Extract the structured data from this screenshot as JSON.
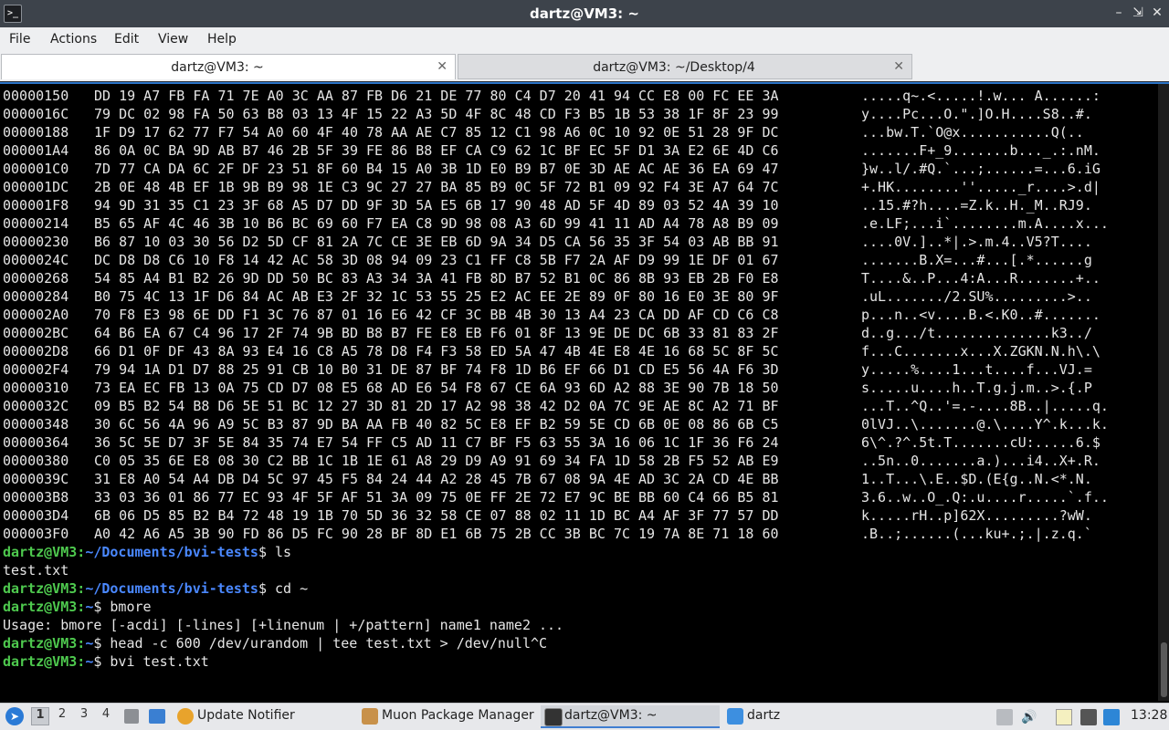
{
  "window": {
    "title": "dartz@VM3: ~",
    "icon": "terminal-icon",
    "controls": [
      "minimize-icon",
      "maximize-icon",
      "close-icon"
    ]
  },
  "menu": [
    "File",
    "Actions",
    "Edit",
    "View",
    "Help"
  ],
  "tabs": [
    {
      "label": "dartz@VM3: ~",
      "active": true
    },
    {
      "label": "dartz@VM3: ~/Desktop/4",
      "active": false
    }
  ],
  "hexdump": [
    {
      "addr": "00000150",
      "bytes": "DD 19 A7 FB FA 71 7E A0 3C AA 87 FB D6 21 DE 77 80 C4 D7 20 41 94 CC E8 00 FC EE 3A",
      "ascii": ".....q~.<.....!.w... A......:"
    },
    {
      "addr": "0000016C",
      "bytes": "79 DC 02 98 FA 50 63 B8 03 13 4F 15 22 A3 5D 4F 8C 48 CD F3 B5 1B 53 38 1F 8F 23 99",
      "ascii": "y....Pc...O.\".]O.H....S8..#."
    },
    {
      "addr": "00000188",
      "bytes": "1F D9 17 62 77 F7 54 A0 60 4F 40 78 AA AE C7 85 12 C1 98 A6 0C 10 92 0E 51 28 9F DC",
      "ascii": "...bw.T.`O@x...........Q(.."
    },
    {
      "addr": "000001A4",
      "bytes": "86 0A 0C BA 9D AB B7 46 2B 5F 39 FE 86 B8 EF CA C9 62 1C BF EC 5F D1 3A E2 6E 4D C6",
      "ascii": ".......F+_9.......b..._.:.nM."
    },
    {
      "addr": "000001C0",
      "bytes": "7D 77 CA DA 6C 2F DF 23 51 8F 60 B4 15 A0 3B 1D E0 B9 B7 0E 3D AE AC AE 36 EA 69 47",
      "ascii": "}w..l/.#Q.`...;......=...6.iG"
    },
    {
      "addr": "000001DC",
      "bytes": "2B 0E 48 4B EF 1B 9B B9 98 1E C3 9C 27 27 BA 85 B9 0C 5F 72 B1 09 92 F4 3E A7 64 7C",
      "ascii": "+.HK........''....._r....>.d|"
    },
    {
      "addr": "000001F8",
      "bytes": "94 9D 31 35 C1 23 3F 68 A5 D7 DD 9F 3D 5A E5 6B 17 90 48 AD 5F 4D 89 03 52 4A 39 10",
      "ascii": "..15.#?h....=Z.k..H._M..RJ9."
    },
    {
      "addr": "00000214",
      "bytes": "B5 65 AF 4C 46 3B 10 B6 BC 69 60 F7 EA C8 9D 98 08 A3 6D 99 41 11 AD A4 78 A8 B9 09",
      "ascii": ".e.LF;...i`........m.A....x..."
    },
    {
      "addr": "00000230",
      "bytes": "B6 87 10 03 30 56 D2 5D CF 81 2A 7C CE 3E EB 6D 9A 34 D5 CA 56 35 3F 54 03 AB BB 91",
      "ascii": "....0V.]..*|.>.m.4..V5?T...."
    },
    {
      "addr": "0000024C",
      "bytes": "DC D8 D8 C6 10 F8 14 42 AC 58 3D 08 94 09 23 C1 FF C8 5B F7 2A AF D9 99 1E DF 01 67",
      "ascii": ".......B.X=...#...[.*......g"
    },
    {
      "addr": "00000268",
      "bytes": "54 85 A4 B1 B2 26 9D DD 50 BC 83 A3 34 3A 41 FB 8D B7 52 B1 0C 86 8B 93 EB 2B F0 E8",
      "ascii": "T....&..P...4:A...R.......+.."
    },
    {
      "addr": "00000284",
      "bytes": "B0 75 4C 13 1F D6 84 AC AB E3 2F 32 1C 53 55 25 E2 AC EE 2E 89 0F 80 16 E0 3E 80 9F",
      "ascii": ".uL......./2.SU%.........>.."
    },
    {
      "addr": "000002A0",
      "bytes": "70 F8 E3 98 6E DD F1 3C 76 87 01 16 E6 42 CF 3C BB 4B 30 13 A4 23 CA DD AF CD C6 C8",
      "ascii": "p...n..<v....B.<.K0..#......."
    },
    {
      "addr": "000002BC",
      "bytes": "64 B6 EA 67 C4 96 17 2F 74 9B BD B8 B7 FE E8 EB F6 01 8F 13 9E DE DC 6B 33 81 83 2F",
      "ascii": "d..g.../t..............k3../"
    },
    {
      "addr": "000002D8",
      "bytes": "66 D1 0F DF 43 8A 93 E4 16 C8 A5 78 D8 F4 F3 58 ED 5A 47 4B 4E E8 4E 16 68 5C 8F 5C",
      "ascii": "f...C.......x...X.ZGKN.N.h\\.\\"
    },
    {
      "addr": "000002F4",
      "bytes": "79 94 1A D1 D7 88 25 91 CB 10 B0 31 DE 87 BF 74 F8 1D B6 EF 66 D1 CD E5 56 4A F6 3D",
      "ascii": "y.....%....1...t....f...VJ.="
    },
    {
      "addr": "00000310",
      "bytes": "73 EA EC FB 13 0A 75 CD D7 08 E5 68 AD E6 54 F8 67 CE 6A 93 6D A2 88 3E 90 7B 18 50",
      "ascii": "s.....u....h..T.g.j.m..>.{.P"
    },
    {
      "addr": "0000032C",
      "bytes": "09 B5 B2 54 B8 D6 5E 51 BC 12 27 3D 81 2D 17 A2 98 38 42 D2 0A 7C 9E AE 8C A2 71 BF",
      "ascii": "...T..^Q..'=.-....8B..|.....q."
    },
    {
      "addr": "00000348",
      "bytes": "30 6C 56 4A 96 A9 5C B3 87 9D BA AA FB 40 82 5C E8 EF B2 59 5E CD 6B 0E 08 86 6B C5",
      "ascii": "0lVJ..\\.......@.\\....Y^.k...k."
    },
    {
      "addr": "00000364",
      "bytes": "36 5C 5E D7 3F 5E 84 35 74 E7 54 FF C5 AD 11 C7 BF F5 63 55 3A 16 06 1C 1F 36 F6 24",
      "ascii": "6\\^.?^.5t.T.......cU:.....6.$"
    },
    {
      "addr": "00000380",
      "bytes": "C0 05 35 6E E8 08 30 C2 BB 1C 1B 1E 61 A8 29 D9 A9 91 69 34 FA 1D 58 2B F5 52 AB E9",
      "ascii": "..5n..0.......a.)...i4..X+.R."
    },
    {
      "addr": "0000039C",
      "bytes": "31 E8 A0 54 A4 DB D4 5C 97 45 F5 84 24 44 A2 28 45 7B 67 08 9A 4E AD 3C 2A CD 4E BB",
      "ascii": "1..T...\\.E..$D.(E{g..N.<*.N."
    },
    {
      "addr": "000003B8",
      "bytes": "33 03 36 01 86 77 EC 93 4F 5F AF 51 3A 09 75 0E FF 2E 72 E7 9C BE BB 60 C4 66 B5 81",
      "ascii": "3.6..w..O_.Q:.u....r.....`.f.."
    },
    {
      "addr": "000003D4",
      "bytes": "6B 06 D5 85 B2 B4 72 48 19 1B 70 5D 36 32 58 CE 07 88 02 11 1D BC A4 AF 3F 77 57 DD",
      "ascii": "k.....rH..p]62X.........?wW."
    },
    {
      "addr": "000003F0",
      "bytes": "A0 42 A6 A5 3B 90 FD 86 D5 FC 90 28 BF 8D E1 6B 75 2B CC 3B BC 7C 19 7A 8E 71 18 60",
      "ascii": ".B..;......(...ku+.;.|.z.q.`"
    }
  ],
  "shell": [
    {
      "type": "prompt",
      "user": "dartz@VM3",
      "path": "~/Documents/bvi-tests",
      "cmd": "ls"
    },
    {
      "type": "output",
      "text": "test.txt"
    },
    {
      "type": "prompt",
      "user": "dartz@VM3",
      "path": "~/Documents/bvi-tests",
      "cmd": "cd ~"
    },
    {
      "type": "prompt",
      "user": "dartz@VM3",
      "path": "~",
      "cmd": "bmore"
    },
    {
      "type": "output",
      "text": "Usage: bmore [-acdi] [-lines] [+linenum | +/pattern] name1 name2 ..."
    },
    {
      "type": "prompt",
      "user": "dartz@VM3",
      "path": "~",
      "cmd": "head -c 600 /dev/urandom | tee test.txt > /dev/null^C"
    },
    {
      "type": "prompt",
      "user": "dartz@VM3",
      "path": "~",
      "cmd": "bvi test.txt"
    }
  ],
  "taskbar": {
    "workspaces": [
      "1",
      "2",
      "3",
      "4"
    ],
    "active_workspace": "1",
    "tasks": [
      {
        "label": "Update Notifier",
        "icon": "update-notifier-icon",
        "color": "#e8a32c"
      },
      {
        "label": "Muon Package Manager",
        "icon": "package-manager-icon",
        "color": "#c8914a"
      },
      {
        "label": "dartz@VM3: ~",
        "icon": "terminal-icon",
        "color": "#333333"
      },
      {
        "label": "dartz",
        "icon": "folder-icon",
        "color": "#3d8fe0"
      }
    ],
    "clock": "13:28"
  },
  "colors": {
    "prompt_user": "#4ec94e",
    "prompt_path": "#4a88ff",
    "terminal_bg": "#000000",
    "accent": "#2b74c7"
  }
}
